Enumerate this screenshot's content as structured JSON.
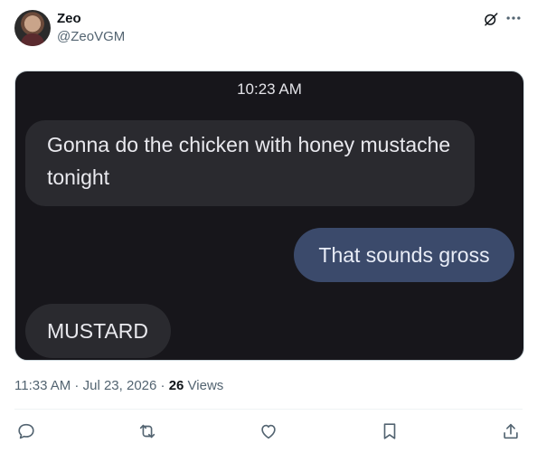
{
  "author": {
    "name": "Zeo",
    "handle": "@ZeoVGM"
  },
  "media": {
    "timestamp": "10:23 AM",
    "messages": [
      {
        "direction": "incoming",
        "text": "Gonna do the chicken with honey mustache tonight"
      },
      {
        "direction": "outgoing",
        "text": "That sounds gross"
      },
      {
        "direction": "incoming",
        "text": "MUSTARD"
      }
    ]
  },
  "meta": {
    "time": "11:33 AM",
    "separator1": " · ",
    "date": "Jul 23, 2026",
    "separator2": " · ",
    "views_count": "26",
    "views_label": " Views"
  },
  "actions": {
    "icons": [
      "reply-icon",
      "repost-icon",
      "like-icon",
      "bookmark-icon",
      "share-icon"
    ]
  },
  "colors": {
    "media_bg": "#17161b",
    "incoming_bubble": "#2a2a2f",
    "outgoing_bubble": "#3b4a6b",
    "secondary_text": "#536471",
    "primary_text": "#0f1419"
  }
}
